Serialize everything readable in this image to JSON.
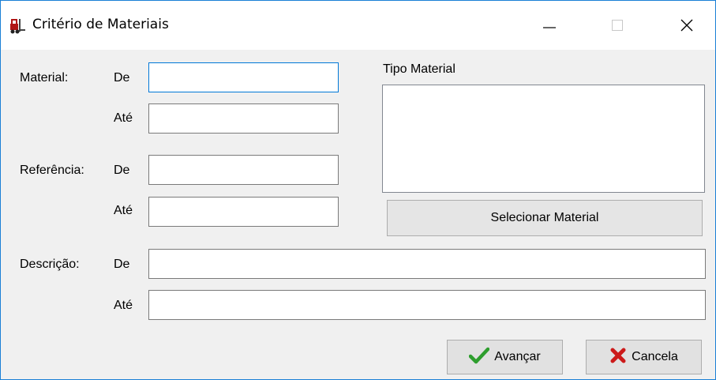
{
  "window": {
    "title": "Critério de Materiais",
    "app_icon": "forklift-icon",
    "controls": [
      "minimize-icon",
      "maximize-icon",
      "close-icon"
    ]
  },
  "form": {
    "material": {
      "label": "Material:",
      "from_label": "De",
      "to_label": "Até",
      "from_value": "",
      "to_value": ""
    },
    "referencia": {
      "label": "Referência:",
      "from_label": "De",
      "to_label": "Até",
      "from_value": "",
      "to_value": ""
    },
    "descricao": {
      "label": "Descrição:",
      "from_label": "De",
      "to_label": "Até",
      "from_value": "",
      "to_value": ""
    },
    "tipo_material": {
      "label": "Tipo Material",
      "items": []
    },
    "select_button_label": "Selecionar Material"
  },
  "actions": {
    "next_label": "Avançar",
    "next_icon": "checkmark-icon",
    "next_icon_color": "#2e9e2e",
    "cancel_label": "Cancela",
    "cancel_icon": "x-icon",
    "cancel_icon_color": "#cc1a1a"
  },
  "colors": {
    "window_border": "#1a7fd6",
    "focus_border": "#0078d7"
  }
}
